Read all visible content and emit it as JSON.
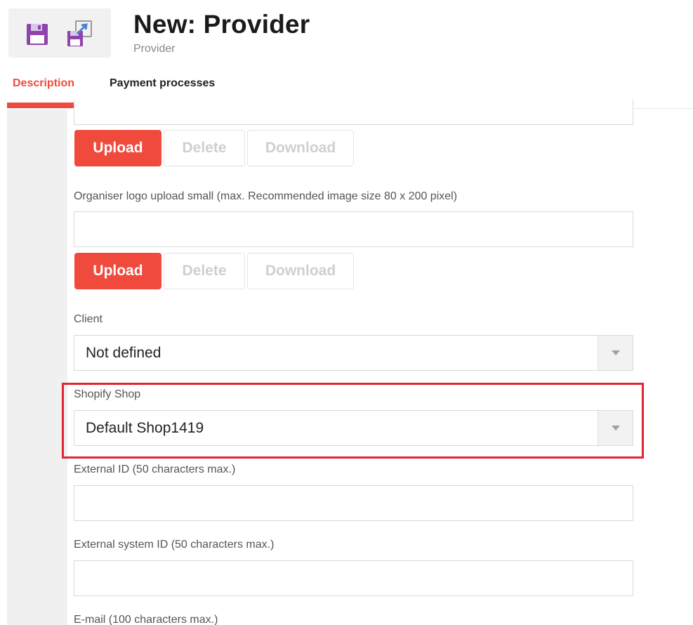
{
  "header": {
    "title": "New: Provider",
    "subtitle": "Provider"
  },
  "toolbar": {
    "save_icon": "save-icon",
    "save_as_icon": "save-as-icon"
  },
  "tabs": [
    {
      "label": "Description",
      "active": true
    },
    {
      "label": "Payment processes",
      "active": false
    }
  ],
  "form": {
    "logo_upload_large": {
      "value": "",
      "buttons": {
        "upload": "Upload",
        "delete": "Delete",
        "download": "Download"
      }
    },
    "logo_upload_small": {
      "label": "Organiser logo upload small (max. Recommended image size 80 x 200 pixel)",
      "value": "",
      "buttons": {
        "upload": "Upload",
        "delete": "Delete",
        "download": "Download"
      }
    },
    "client": {
      "label": "Client",
      "value": "Not defined"
    },
    "shopify_shop": {
      "label": "Shopify Shop",
      "value": "Default Shop1419"
    },
    "external_id": {
      "label": "External ID (50 characters max.)",
      "value": ""
    },
    "external_system_id": {
      "label": "External system ID (50 characters max.)",
      "value": ""
    },
    "email": {
      "label": "E-mail (100 characters max.)"
    }
  },
  "colors": {
    "accent": "#f04a3c",
    "highlight": "#e02434",
    "save_icon": "#8e44ad",
    "save_as_icon": "#4a7fd4"
  }
}
